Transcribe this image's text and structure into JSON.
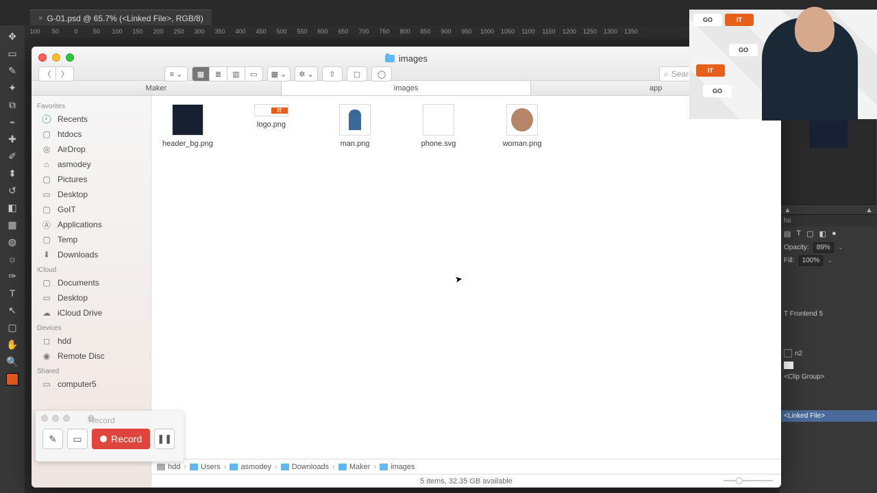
{
  "photoshop": {
    "tab_title": "G-01.psd @ 65.7% (<Linked File>, RGB/8)",
    "ruler_marks": [
      "100",
      "50",
      "0",
      "50",
      "100",
      "150",
      "200",
      "250",
      "300",
      "350",
      "400",
      "450",
      "500",
      "550",
      "600",
      "650",
      "700",
      "750",
      "800",
      "850",
      "900",
      "950",
      "1000",
      "1050",
      "1100",
      "1150",
      "1200",
      "1250",
      "1300",
      "1350"
    ],
    "opacity_label": "Opacity:",
    "opacity_value": "89%",
    "fill_label": "Fill:",
    "fill_value": "100%",
    "layer_frontend": "T Frontend  5",
    "clip_group": "<Clip Group>",
    "layer_hs": "hs",
    "linked_file": "<Linked File>"
  },
  "finder": {
    "title": "images",
    "search_placeholder": "Search",
    "tabs": [
      {
        "label": "Maker"
      },
      {
        "label": "images"
      },
      {
        "label": "app"
      }
    ],
    "sidebar": {
      "sections": [
        {
          "title": "Favorites",
          "items": [
            "Recents",
            "htdocs",
            "AirDrop",
            "asmodey",
            "Pictures",
            "Desktop",
            "GoIT",
            "Applications",
            "Temp",
            "Downloads"
          ]
        },
        {
          "title": "iCloud",
          "items": [
            "Documents",
            "Desktop",
            "iCloud Drive"
          ]
        },
        {
          "title": "Devices",
          "items": [
            "hdd",
            "Remote Disc"
          ]
        },
        {
          "title": "Shared",
          "items": [
            "computer5"
          ]
        }
      ]
    },
    "files": [
      {
        "name": "header_bg.png"
      },
      {
        "name": "logo.png"
      },
      {
        "name": "man.png"
      },
      {
        "name": "phone.svg"
      },
      {
        "name": "woman.png"
      }
    ],
    "path": [
      "hdd",
      "Users",
      "asmodey",
      "Downloads",
      "Maker",
      "images"
    ],
    "status": "5 items, 32.35 GB available"
  },
  "recorder": {
    "title": "Record",
    "button": "Record"
  },
  "webcam": {
    "badge_go": "GO",
    "badge_it": "IT"
  }
}
